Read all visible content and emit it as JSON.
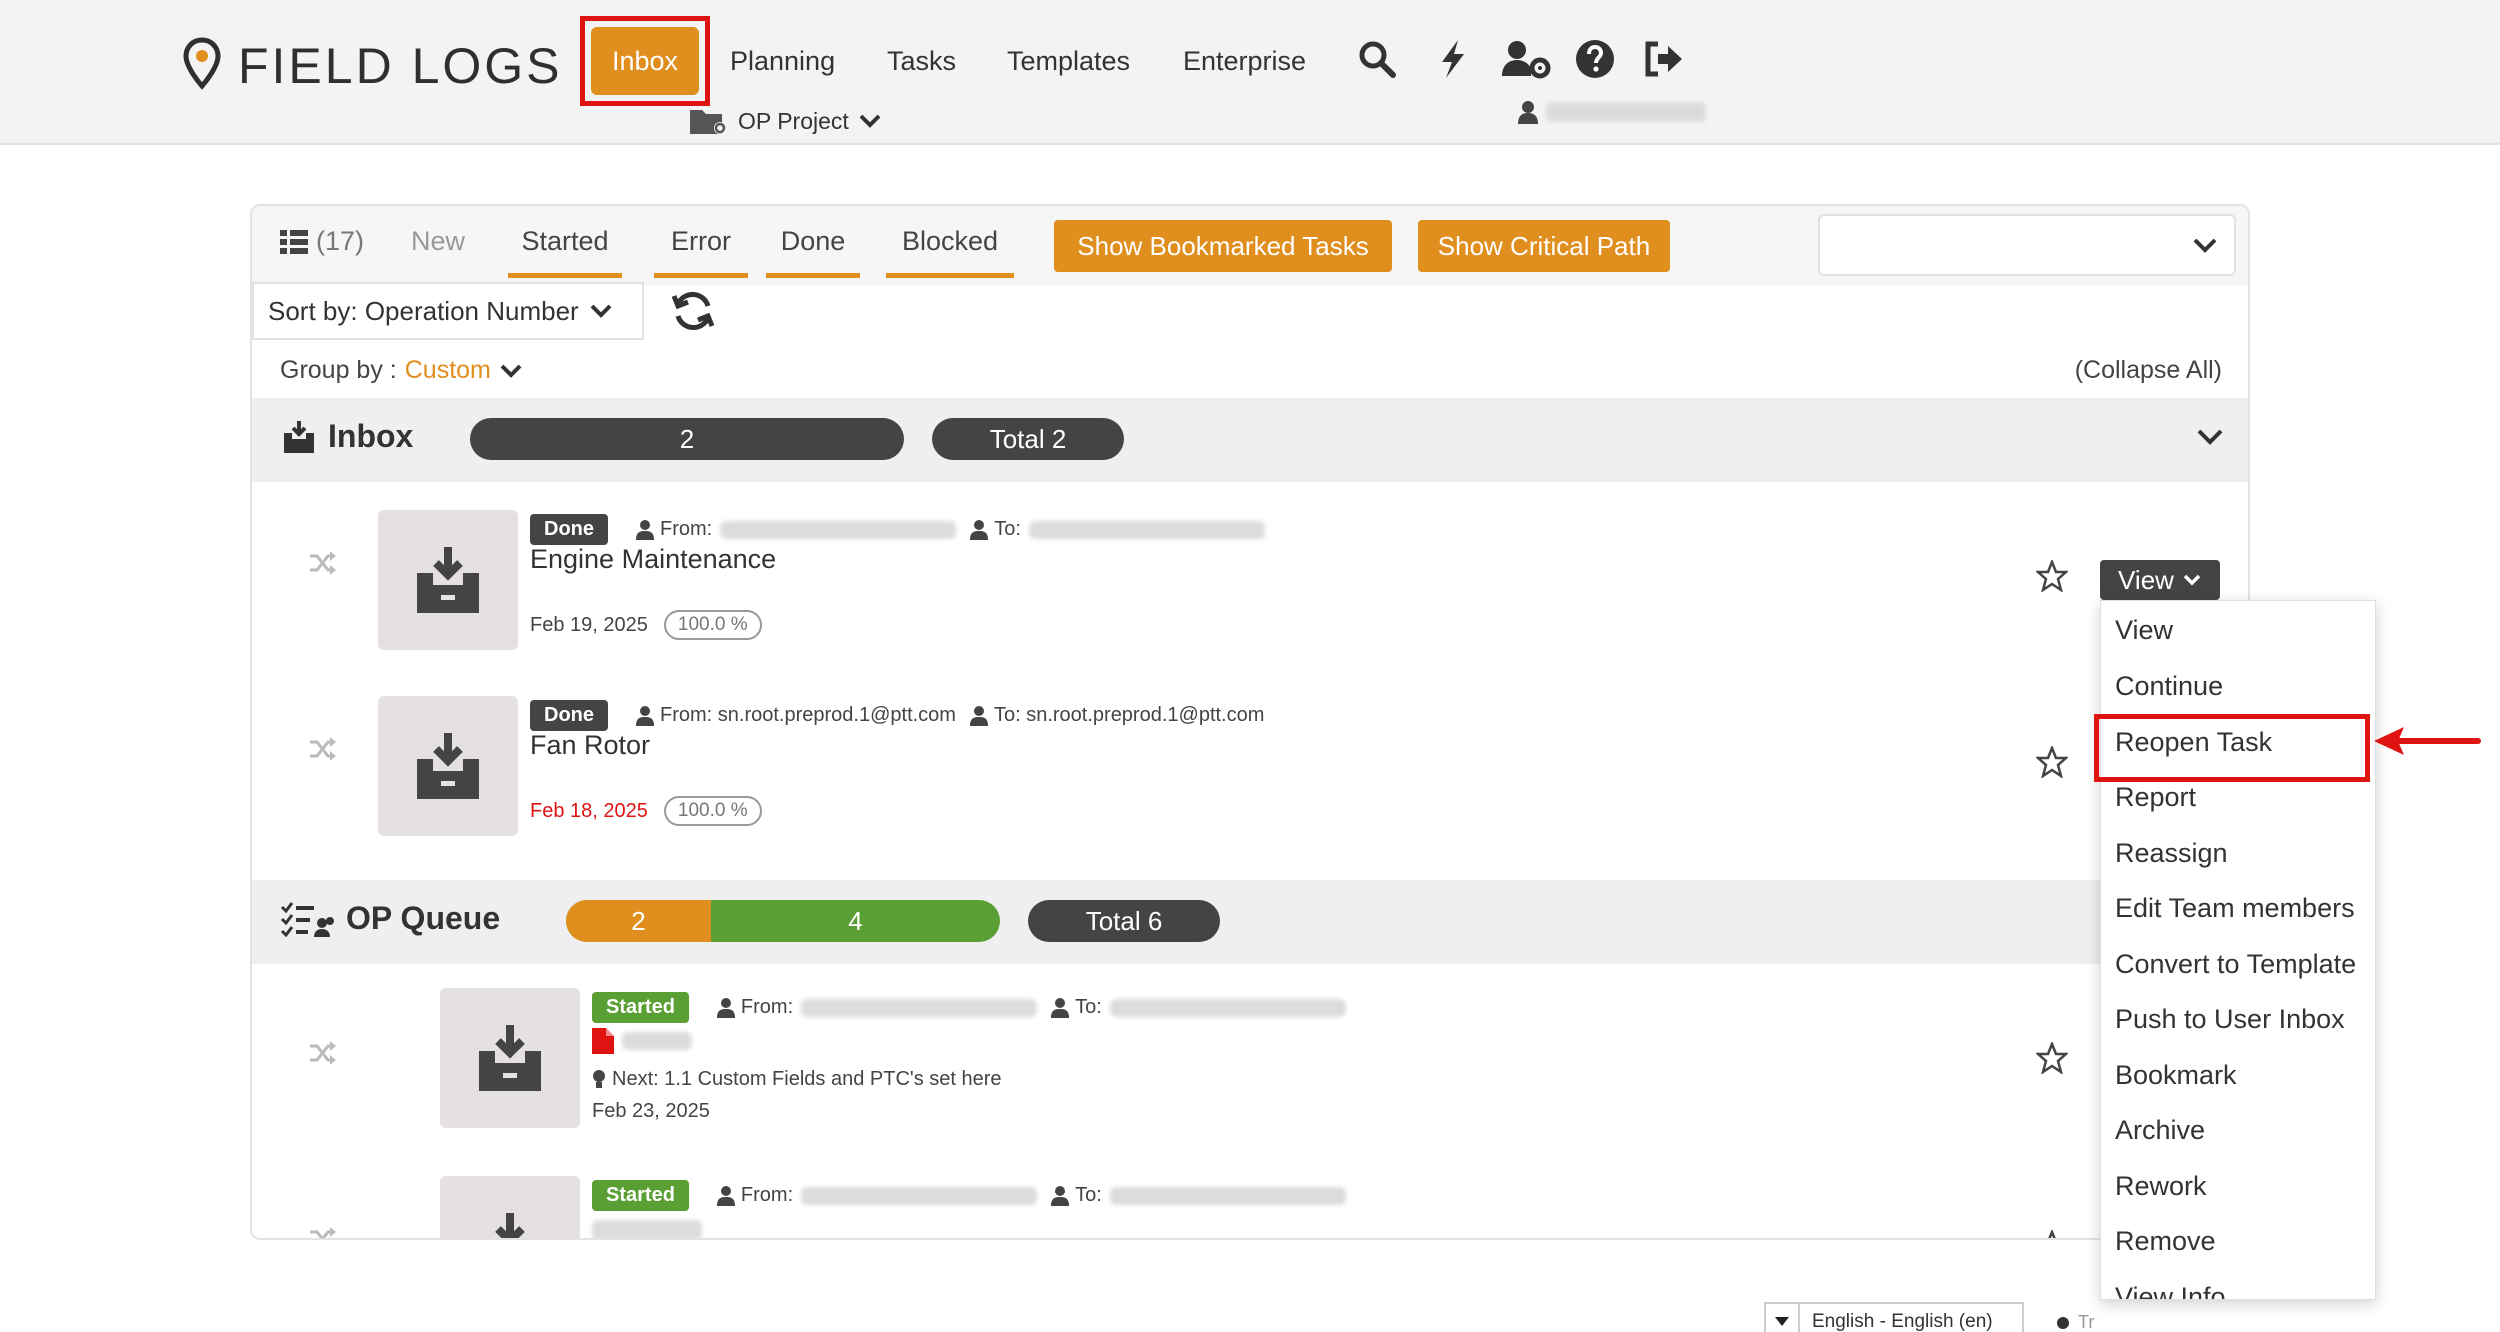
{
  "app": {
    "logo_text": "FIELD LOGS"
  },
  "nav": {
    "inbox": "Inbox",
    "planning": "Planning",
    "tasks": "Tasks",
    "templates": "Templates",
    "enterprise": "Enterprise",
    "project": "OP Project",
    "icons": [
      "search-icon",
      "bolt-icon",
      "user-settings-icon",
      "help-icon",
      "logout-icon"
    ]
  },
  "toolbar": {
    "count": "(17)",
    "tabs": [
      "New",
      "Started",
      "Error",
      "Done",
      "Blocked"
    ],
    "bookmarked_btn": "Show Bookmarked Tasks",
    "critical_btn": "Show Critical Path",
    "sort_label": "Sort by: Operation Number",
    "group_label": "Group by :",
    "group_value": "Custom",
    "collapse": "(Collapse All)"
  },
  "groups": {
    "inbox": {
      "title": "Inbox",
      "count": "2",
      "total": "Total 2"
    },
    "opqueue": {
      "title": "OP Queue",
      "orange": "2",
      "green": "4",
      "total": "Total 6"
    }
  },
  "tasks": [
    {
      "status": "Done",
      "from_label": "From:",
      "to_label": "To:",
      "name": "Engine Maintenance",
      "date": "Feb 19, 2025",
      "pct": "100.0 %"
    },
    {
      "status": "Done",
      "from_label": "From: sn.root.preprod.1@ptt.com",
      "to_label": "To: sn.root.preprod.1@ptt.com",
      "name": "Fan Rotor",
      "date": "Feb 18, 2025",
      "pct": "100.0 %"
    },
    {
      "status": "Started",
      "from_label": "From:",
      "to_label": "To:",
      "next": "Next: 1.1 Custom Fields and PTC's set here",
      "date": "Feb 23, 2025"
    },
    {
      "status": "Started",
      "from_label": "From:",
      "to_label": "To:"
    }
  ],
  "view_button": "View",
  "dropdown": [
    "View",
    "Continue",
    "Reopen Task",
    "Report",
    "Reassign",
    "Edit Team members",
    "Convert to Template",
    "Push to User Inbox",
    "Bookmark",
    "Archive",
    "Rework",
    "Remove",
    "View Info"
  ],
  "footer": {
    "language": "English - English (en)",
    "extra": "Tr"
  },
  "colors": {
    "accent": "#e08e1d",
    "highlight": "#e01313",
    "started": "#5a9f33",
    "dark": "#444444"
  }
}
